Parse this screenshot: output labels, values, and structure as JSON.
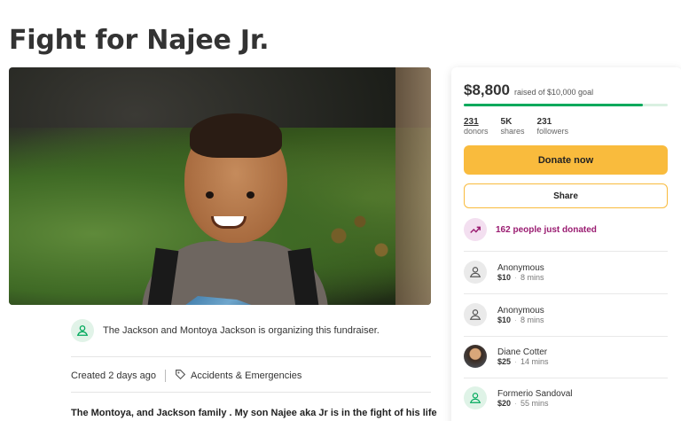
{
  "page": {
    "title": "Fight for Najee Jr."
  },
  "organizer": {
    "text": "The Jackson and Montoya Jackson is organizing this fundraiser.",
    "icon": "person-icon"
  },
  "meta": {
    "created": "Created 2 days ago",
    "category": "Accidents & Emergencies",
    "category_icon": "tag-icon"
  },
  "story": {
    "preview": "The Montoya, and Jackson family . My son Najee aka Jr is in the fight of his life"
  },
  "donation_card": {
    "raised_amount": "$8,800",
    "raised_of": "raised of $10,000 goal",
    "progress_fraction": 0.88,
    "stats": [
      {
        "value": "231",
        "label": "donors"
      },
      {
        "value": "5K",
        "label": "shares"
      },
      {
        "value": "231",
        "label": "followers"
      }
    ],
    "donate_label": "Donate now",
    "share_label": "Share",
    "trend_text": "162 people just donated",
    "donors": [
      {
        "name": "Anonymous",
        "amount": "$10",
        "time": "8 mins",
        "avatar": "person-icon"
      },
      {
        "name": "Anonymous",
        "amount": "$10",
        "time": "8 mins",
        "avatar": "person-icon"
      },
      {
        "name": "Diane Cotter",
        "amount": "$25",
        "time": "14 mins",
        "avatar": "photo"
      },
      {
        "name": "Formerio Sandoval",
        "amount": "$20",
        "time": "55 mins",
        "avatar": "person-icon"
      }
    ]
  },
  "colors": {
    "progress": "#02a95c",
    "donate_button": "#f9bb3d",
    "trend_text": "#9a1c71"
  }
}
